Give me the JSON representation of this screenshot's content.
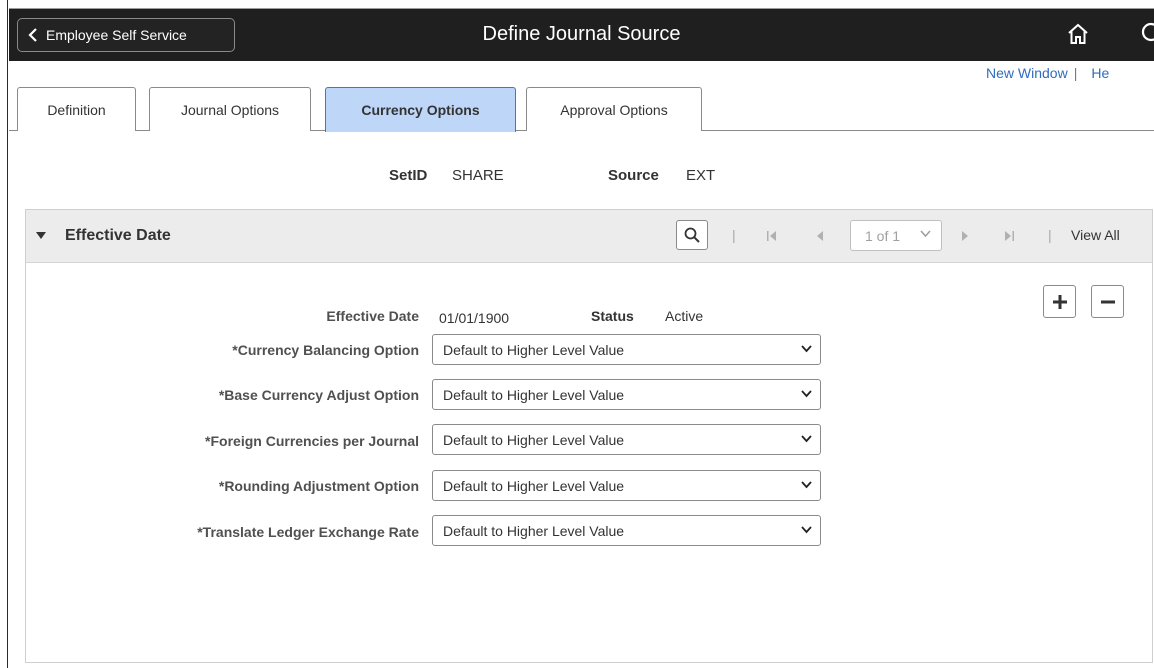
{
  "banner": {
    "back_label": "Employee Self Service",
    "title": "Define Journal Source"
  },
  "util_links": {
    "new_window": "New Window",
    "separator": "|",
    "help": "He"
  },
  "tabs": [
    {
      "label": "Definition",
      "active": false
    },
    {
      "label": "Journal Options",
      "active": false
    },
    {
      "label": "Currency Options",
      "active": true
    },
    {
      "label": "Approval Options",
      "active": false
    }
  ],
  "ids": {
    "setid_label": "SetID",
    "setid_value": "SHARE",
    "source_label": "Source",
    "source_value": "EXT"
  },
  "panel": {
    "title": "Effective Date",
    "nav_separator": "|",
    "page_value": "1 of 1",
    "view_all": "View All",
    "effective_date_label": "Effective Date",
    "effective_date_value": "01/01/1900",
    "status_label": "Status",
    "status_value": "Active",
    "fields": [
      {
        "label": "*Currency Balancing Option",
        "value": "Default to Higher Level Value"
      },
      {
        "label": "*Base Currency Adjust Option",
        "value": "Default to Higher Level Value"
      },
      {
        "label": "*Foreign Currencies per Journal",
        "value": "Default to Higher Level Value"
      },
      {
        "label": "*Rounding Adjustment Option",
        "value": "Default to Higher Level Value"
      },
      {
        "label": "*Translate Ledger Exchange Rate",
        "value": "Default to Higher Level Value"
      }
    ]
  },
  "colors": {
    "banner_bg": "#1f1f1f",
    "active_tab": "#bed6f7",
    "link": "#2f6dbf"
  },
  "icons": [
    "chevron-left-icon",
    "home-icon",
    "search-icon",
    "first-page-icon",
    "previous-icon",
    "next-icon",
    "last-page-icon",
    "add-row-icon",
    "delete-row-icon",
    "chevron-down-icon"
  ]
}
